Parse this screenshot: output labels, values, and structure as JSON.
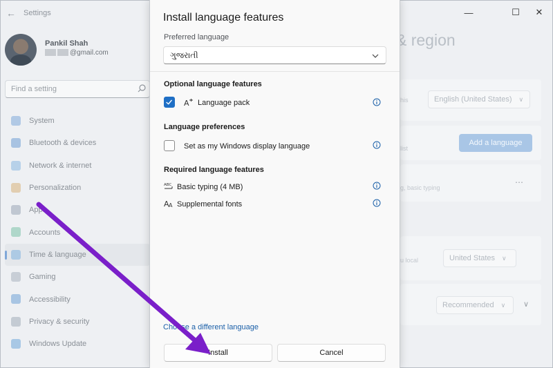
{
  "settings": {
    "app_title": "Settings",
    "user": {
      "name": "Pankil Shah",
      "email_suffix": "@gmail.com"
    },
    "search_placeholder": "Find a setting",
    "nav": [
      {
        "label": "System",
        "color": "#7fa9d8"
      },
      {
        "label": "Bluetooth & devices",
        "color": "#6f9fd4"
      },
      {
        "label": "Network & internet",
        "color": "#8ab8e0"
      },
      {
        "label": "Personalization",
        "color": "#d9b27a"
      },
      {
        "label": "Apps",
        "color": "#9aa6b4"
      },
      {
        "label": "Accounts",
        "color": "#7cc3a8"
      },
      {
        "label": "Time & language",
        "color": "#7fb2de"
      },
      {
        "label": "Gaming",
        "color": "#a9b3bd"
      },
      {
        "label": "Accessibility",
        "color": "#6fa3d6"
      },
      {
        "label": "Privacy & security",
        "color": "#a3adb8"
      },
      {
        "label": "Windows Update",
        "color": "#6fa8d8"
      }
    ],
    "active_nav_index": 6,
    "page_title_fragment": "& region",
    "region_rows": {
      "row1_text": "his",
      "row1_value": "English (United States)",
      "row2_text": "list",
      "add_language_label": "Add a language",
      "row3_text": "g, basic typing",
      "row4_text": "u local",
      "row4_value": "United States",
      "row5_value": "Recommended"
    }
  },
  "dialog": {
    "title": "Install language features",
    "preferred_language_label": "Preferred language",
    "preferred_language_value": "ગુજરાતી",
    "optional_section": "Optional language features",
    "language_pack_label": "Language pack",
    "language_pack_checked": true,
    "preferences_section": "Language preferences",
    "display_language_label": "Set as my Windows display language",
    "display_language_checked": false,
    "required_section": "Required language features",
    "basic_typing_label": "Basic typing (4 MB)",
    "supplemental_fonts_label": "Supplemental fonts",
    "choose_different_link": "Choose a different language",
    "install_label": "Install",
    "cancel_label": "Cancel",
    "accent_color": "#1f6fc5"
  },
  "annotation": {
    "arrow_color": "#7a1fc9"
  }
}
